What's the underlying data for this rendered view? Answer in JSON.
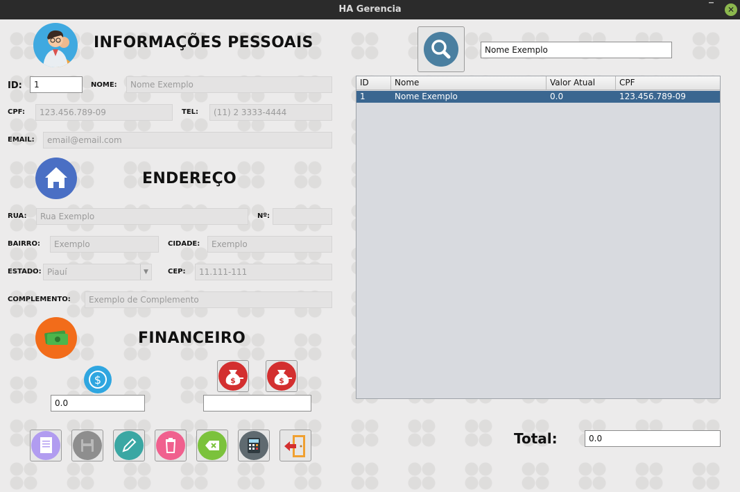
{
  "window": {
    "title": "HA Gerencia",
    "minimize_glyph": "‾",
    "close_glyph": "✕"
  },
  "personal": {
    "heading": "INFORMAÇÕES PESSOAIS",
    "id_label": "ID:",
    "id_value": "1",
    "name_label": "NOME:",
    "name_placeholder": "Nome Exemplo",
    "cpf_label": "CPF:",
    "cpf_placeholder": "123.456.789-09",
    "tel_label": "TEL:",
    "tel_placeholder": "(11) 2 3333-4444",
    "email_label": "EMAIL:",
    "email_placeholder": "email@email.com"
  },
  "address": {
    "heading": "ENDEREÇO",
    "street_label": "RUA:",
    "street_placeholder": "Rua Exemplo",
    "number_label": "Nº:",
    "number_value": "",
    "district_label": "BAIRRO:",
    "district_placeholder": "Exemplo",
    "city_label": "CIDADE:",
    "city_placeholder": "Exemplo",
    "state_label": "ESTADO:",
    "state_selected": "Piauí",
    "cep_label": "CEP:",
    "cep_placeholder": "11.111-111",
    "complement_label": "COMPLEMENTO:",
    "complement_placeholder": "Exemplo de Complemento"
  },
  "financial": {
    "heading": "FINANCEIRO",
    "balance_value": "0.0",
    "amount_value": ""
  },
  "search": {
    "value": "Nome Exemplo"
  },
  "table": {
    "columns": [
      "ID",
      "Nome",
      "Valor Atual",
      "CPF"
    ],
    "rows": [
      {
        "id": "1",
        "nome": "Nome Exemplo",
        "valor": "0.0",
        "cpf": "123.456.789-09"
      }
    ]
  },
  "total": {
    "label": "Total:",
    "value": "0.0"
  },
  "colors": {
    "selection_row": "#3a6690",
    "search_button": "#4a7fa0",
    "finance_icon": "#f26c1a",
    "money_bag_buttons": "#d32f2f"
  },
  "icons": [
    "user-avatar-icon",
    "search-icon",
    "home-icon",
    "cash-icon",
    "dollar-icon",
    "money-bag-add-icon",
    "money-bag-remove-icon",
    "new-document-icon",
    "save-icon",
    "edit-icon",
    "trash-icon",
    "clear-icon",
    "calculator-icon",
    "exit-icon"
  ]
}
